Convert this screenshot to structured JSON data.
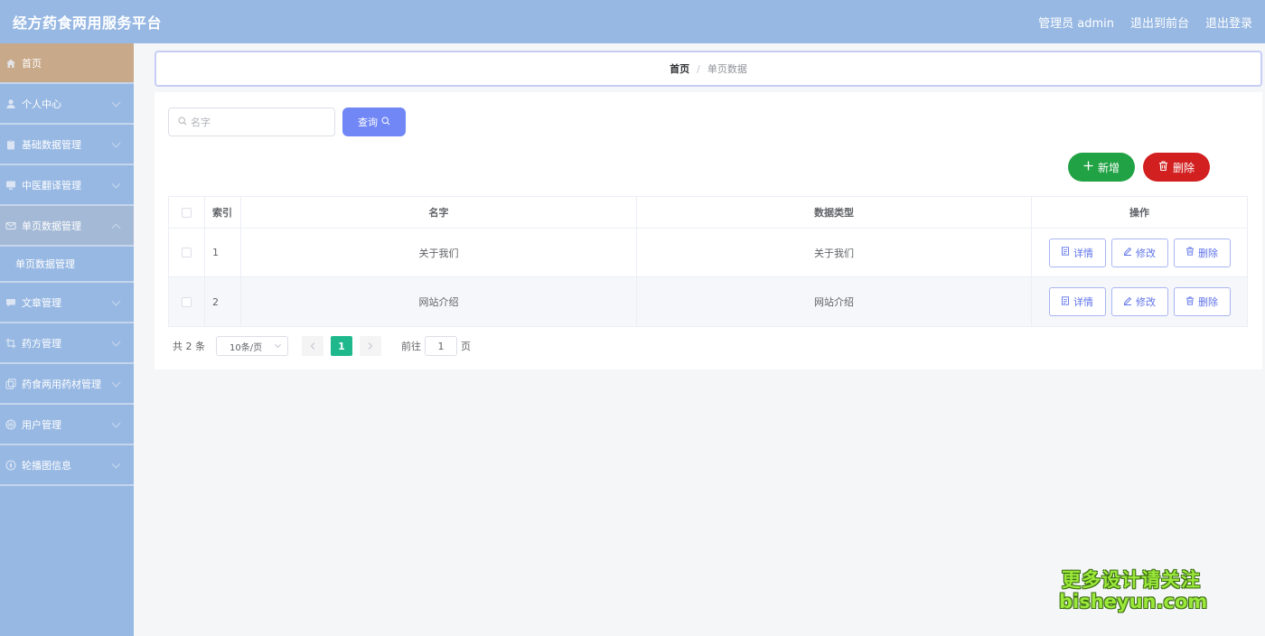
{
  "header": {
    "title": "经方药食两用服务平台",
    "admin_label": "管理员 admin",
    "front_label": "退出到前台",
    "logout_label": "退出登录"
  },
  "sidebar": {
    "items": [
      {
        "label": "首页"
      },
      {
        "label": "个人中心"
      },
      {
        "label": "基础数据管理"
      },
      {
        "label": "中医翻译管理"
      },
      {
        "label": "单页数据管理"
      },
      {
        "label": "单页数据管理"
      },
      {
        "label": "文章管理"
      },
      {
        "label": "药方管理"
      },
      {
        "label": "药食两用药材管理"
      },
      {
        "label": "用户管理"
      },
      {
        "label": "轮播图信息"
      }
    ]
  },
  "breadcrumb": {
    "home": "首页",
    "separator": "/",
    "current": "单页数据"
  },
  "search": {
    "placeholder": "名字",
    "query_label": "查询"
  },
  "actions": {
    "add_label": "新增",
    "delete_label": "删除"
  },
  "table": {
    "headers": {
      "index": "索引",
      "name": "名字",
      "type": "数据类型",
      "ops": "操作"
    },
    "rows": [
      {
        "index": "1",
        "name": "关于我们",
        "type": "关于我们"
      },
      {
        "index": "2",
        "name": "网站介绍",
        "type": "网站介绍"
      }
    ],
    "op_labels": {
      "detail": "详情",
      "edit": "修改",
      "delete": "删除"
    }
  },
  "pagination": {
    "total": "共 2 条",
    "page_size": "10条/页",
    "current_page": "1",
    "goto_prefix": "前往",
    "goto_value": "1",
    "goto_suffix": "页"
  },
  "watermark": {
    "line1": "更多设计请关注",
    "line2": "bisheyun.com"
  },
  "colors": {
    "header_bg": "#97b8e3",
    "home_active": "#c8a98a",
    "query_btn": "#7087f5",
    "add_btn": "#21a244",
    "delete_btn": "#d21f1f",
    "page_active": "#1fb88c"
  }
}
